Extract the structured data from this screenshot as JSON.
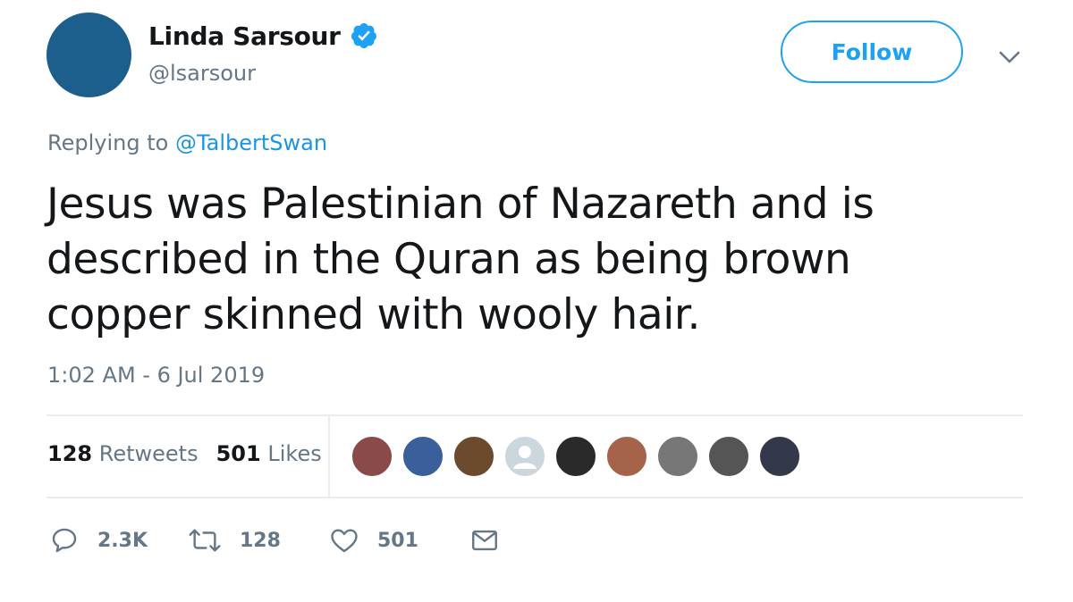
{
  "author": {
    "display_name": "Linda Sarsour",
    "handle": "@lsarsour",
    "verified": true,
    "avatar_color": "#1d5f8c"
  },
  "follow_button": {
    "label": "Follow"
  },
  "reply": {
    "prefix": "Replying to",
    "mention": "@TalbertSwan"
  },
  "tweet": {
    "text_lines": [
      "Jesus was Palestinian of Nazareth and is",
      "described in the Quran as being brown",
      "copper skinned with wooly hair."
    ],
    "timestamp": "1:02 AM - 6 Jul 2019"
  },
  "stats": {
    "retweets_count": "128",
    "retweets_label": "Retweets",
    "likes_count": "501",
    "likes_label": "Likes"
  },
  "facepile": [
    {
      "icon": "user-avatar-1",
      "color": "#8a4a4a"
    },
    {
      "icon": "user-avatar-2",
      "color": "#3b5f9a"
    },
    {
      "icon": "user-avatar-3",
      "color": "#6b4a2e"
    },
    {
      "icon": "default-avatar-icon",
      "color": "#ccd6dd"
    },
    {
      "icon": "user-avatar-5",
      "color": "#2a2a2a"
    },
    {
      "icon": "user-avatar-6",
      "color": "#a5644a"
    },
    {
      "icon": "user-avatar-7",
      "color": "#777777"
    },
    {
      "icon": "user-avatar-8",
      "color": "#555555"
    },
    {
      "icon": "user-avatar-9",
      "color": "#33394a"
    }
  ],
  "actions": {
    "reply_count": "2.3K",
    "retweet_count": "128",
    "like_count": "501"
  },
  "colors": {
    "accent": "#1da1f2",
    "mention": "#1b95e0",
    "muted": "#657786",
    "text": "#14171a",
    "divider": "#e6ecf0"
  }
}
